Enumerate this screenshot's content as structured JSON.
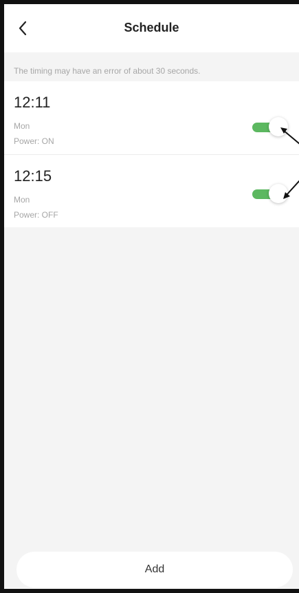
{
  "header": {
    "title": "Schedule",
    "back_icon": "chevron-left-icon"
  },
  "notice": "The timing may have an error of about 30 seconds.",
  "schedules": [
    {
      "time": "12:11",
      "day": "Mon",
      "power": "Power: ON",
      "enabled": true
    },
    {
      "time": "12:15",
      "day": "Mon",
      "power": "Power: OFF",
      "enabled": true
    }
  ],
  "add_button": {
    "label": "Add"
  },
  "colors": {
    "toggle_on": "#5cb860",
    "background": "#f4f4f4",
    "card": "#ffffff",
    "muted_text": "#a6a6a6"
  }
}
